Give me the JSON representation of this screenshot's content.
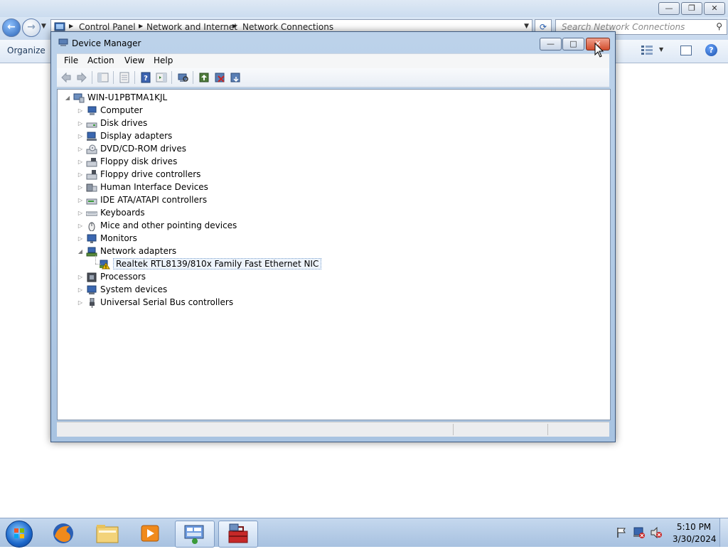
{
  "explorer": {
    "breadcrumbs": [
      "Control Panel",
      "Network and Internet",
      "Network Connections"
    ],
    "search_placeholder": "Search Network Connections",
    "organize_label": "Organize"
  },
  "devmgr": {
    "title": "Device Manager",
    "menu": [
      "File",
      "Action",
      "View",
      "Help"
    ],
    "root": "WIN-U1PBTMA1KJL",
    "categories": [
      "Computer",
      "Disk drives",
      "Display adapters",
      "DVD/CD-ROM drives",
      "Floppy disk drives",
      "Floppy drive controllers",
      "Human Interface Devices",
      "IDE ATA/ATAPI controllers",
      "Keyboards",
      "Mice and other pointing devices",
      "Monitors",
      "Network adapters",
      "Processors",
      "System devices",
      "Universal Serial Bus controllers"
    ],
    "network_child": "Realtek RTL8139/810x Family Fast Ethernet NIC"
  },
  "taskbar": {
    "time": "5:10 PM",
    "date": "3/30/2024"
  }
}
